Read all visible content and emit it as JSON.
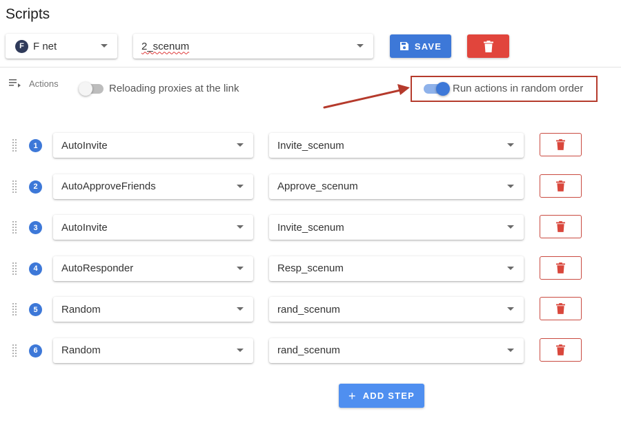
{
  "page": {
    "title": "Scripts"
  },
  "account_select": {
    "avatar_letter": "F",
    "value": "F net"
  },
  "script_select": {
    "value": "2_scenum"
  },
  "toolbar": {
    "save_label": "SAVE",
    "save_icon": "floppy-disk-icon",
    "delete_icon": "trash-icon"
  },
  "options": {
    "actions_label": "Actions",
    "reload_proxies": {
      "label": "Reloading proxies at the link",
      "enabled": false
    },
    "random_order": {
      "label": "Run actions in random order",
      "enabled": true
    }
  },
  "steps": [
    {
      "number": "1",
      "action": "AutoInvite",
      "scenario": "Invite_scenum"
    },
    {
      "number": "2",
      "action": "AutoApproveFriends",
      "scenario": "Approve_scenum"
    },
    {
      "number": "3",
      "action": "AutoInvite",
      "scenario": "Invite_scenum"
    },
    {
      "number": "4",
      "action": "AutoResponder",
      "scenario": "Resp_scenum"
    },
    {
      "number": "5",
      "action": "Random",
      "scenario": "rand_scenum"
    },
    {
      "number": "6",
      "action": "Random",
      "scenario": "rand_scenum"
    }
  ],
  "add_step": {
    "label": "ADD STEP"
  },
  "colors": {
    "primary": "#3d78d8",
    "danger": "#e1453c",
    "annotation": "#b53a2c"
  }
}
